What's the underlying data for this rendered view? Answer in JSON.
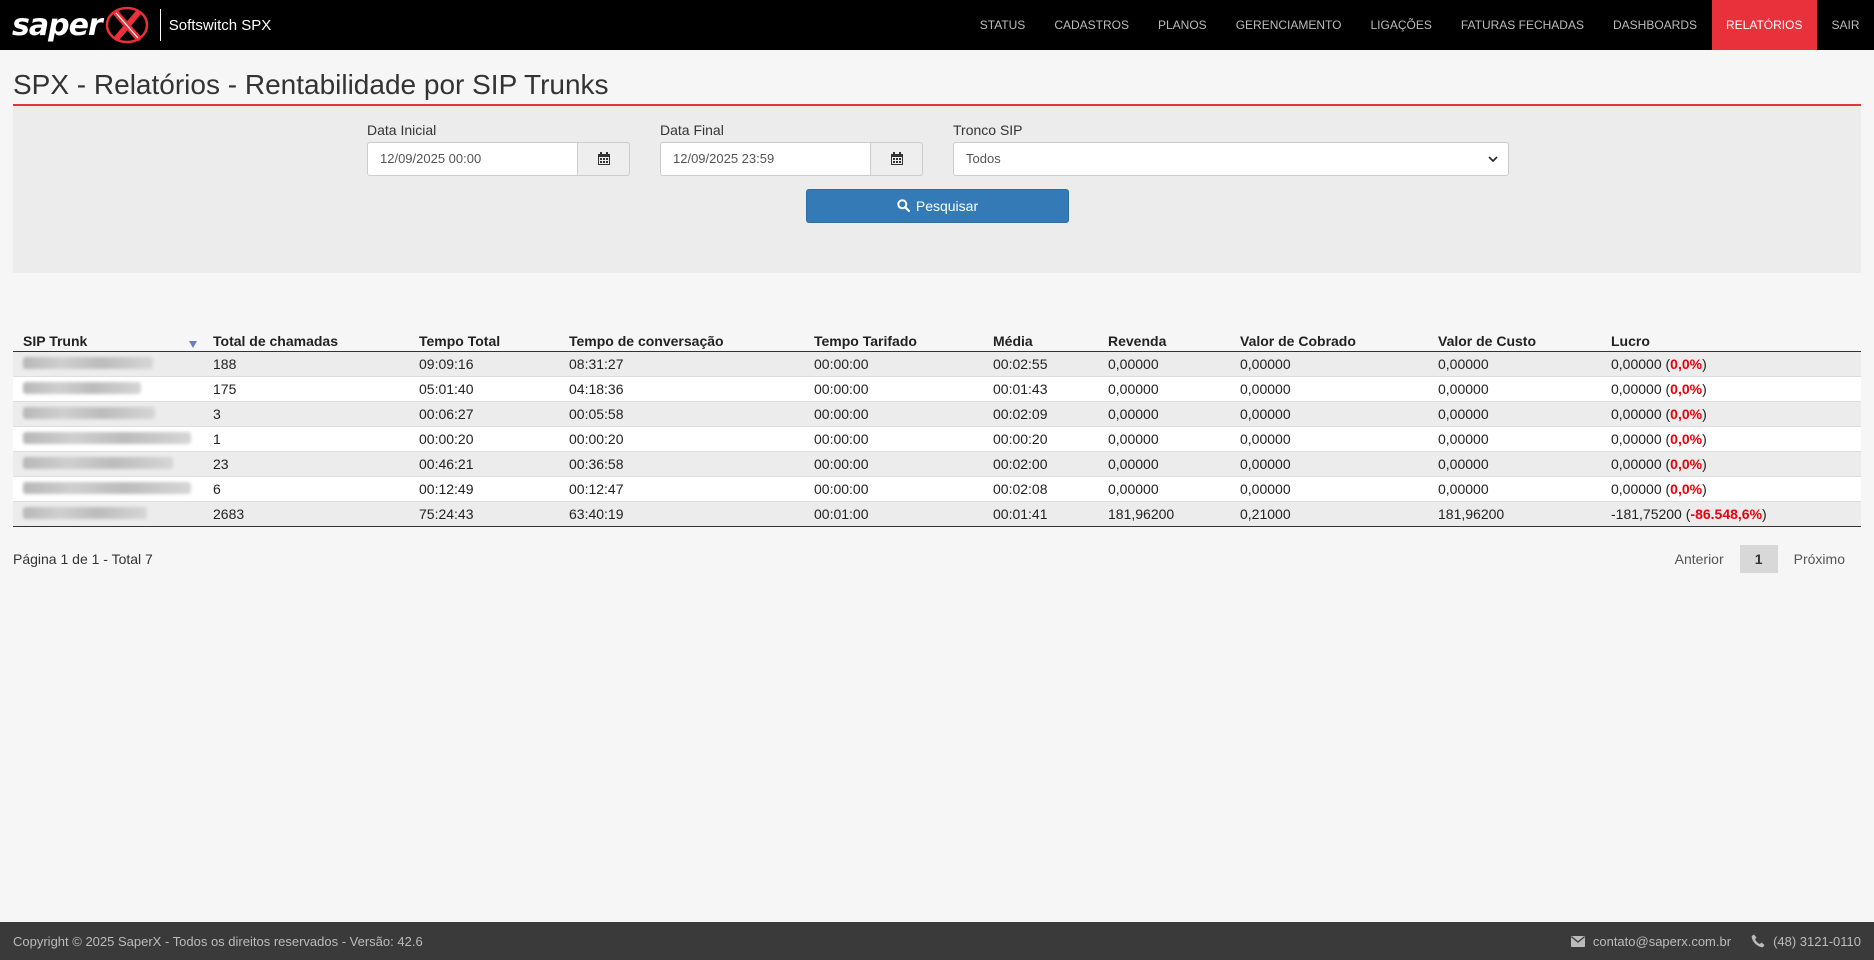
{
  "brand": {
    "logo_text": "saper",
    "product": "Softswitch SPX"
  },
  "nav": [
    {
      "label": "STATUS",
      "name": "nav-status"
    },
    {
      "label": "CADASTROS",
      "name": "nav-cadastros"
    },
    {
      "label": "PLANOS",
      "name": "nav-planos"
    },
    {
      "label": "GERENCIAMENTO",
      "name": "nav-gerenciamento"
    },
    {
      "label": "LIGAÇÕES",
      "name": "nav-ligacoes"
    },
    {
      "label": "FATURAS FECHADAS",
      "name": "nav-faturas-fechadas"
    },
    {
      "label": "DASHBOARDS",
      "name": "nav-dashboards"
    },
    {
      "label": "RELATÓRIOS",
      "name": "nav-relatorios",
      "active": true
    },
    {
      "label": "SAIR",
      "name": "nav-sair"
    }
  ],
  "page": {
    "title": "SPX - Relatórios - Rentabilidade por SIP Trunks"
  },
  "filters": {
    "start_label": "Data Inicial",
    "start_value": "12/09/2025 00:00",
    "end_label": "Data Final",
    "end_value": "12/09/2025 23:59",
    "trunk_label": "Tronco SIP",
    "trunk_value": "Todos",
    "search_label": "Pesquisar"
  },
  "table": {
    "columns": [
      "SIP Trunk",
      "Total de chamadas",
      "Tempo Total",
      "Tempo de conversação",
      "Tempo Tarifado",
      "Média",
      "Revenda",
      "Valor de Cobrado",
      "Valor de Custo",
      "Lucro"
    ],
    "rows": [
      {
        "total": "188",
        "tempo_total": "09:09:16",
        "conversacao": "08:31:27",
        "tarifado": "00:00:00",
        "media": "00:02:55",
        "revenda": "0,00000",
        "cobrado": "0,00000",
        "custo": "0,00000",
        "lucro": "0,00000",
        "lucro_pct": "0,0%"
      },
      {
        "total": "175",
        "tempo_total": "05:01:40",
        "conversacao": "04:18:36",
        "tarifado": "00:00:00",
        "media": "00:01:43",
        "revenda": "0,00000",
        "cobrado": "0,00000",
        "custo": "0,00000",
        "lucro": "0,00000",
        "lucro_pct": "0,0%"
      },
      {
        "total": "3",
        "tempo_total": "00:06:27",
        "conversacao": "00:05:58",
        "tarifado": "00:00:00",
        "media": "00:02:09",
        "revenda": "0,00000",
        "cobrado": "0,00000",
        "custo": "0,00000",
        "lucro": "0,00000",
        "lucro_pct": "0,0%"
      },
      {
        "total": "1",
        "tempo_total": "00:00:20",
        "conversacao": "00:00:20",
        "tarifado": "00:00:00",
        "media": "00:00:20",
        "revenda": "0,00000",
        "cobrado": "0,00000",
        "custo": "0,00000",
        "lucro": "0,00000",
        "lucro_pct": "0,0%"
      },
      {
        "total": "23",
        "tempo_total": "00:46:21",
        "conversacao": "00:36:58",
        "tarifado": "00:00:00",
        "media": "00:02:00",
        "revenda": "0,00000",
        "cobrado": "0,00000",
        "custo": "0,00000",
        "lucro": "0,00000",
        "lucro_pct": "0,0%"
      },
      {
        "total": "6",
        "tempo_total": "00:12:49",
        "conversacao": "00:12:47",
        "tarifado": "00:00:00",
        "media": "00:02:08",
        "revenda": "0,00000",
        "cobrado": "0,00000",
        "custo": "0,00000",
        "lucro": "0,00000",
        "lucro_pct": "0,0%"
      },
      {
        "total": "2683",
        "tempo_total": "75:24:43",
        "conversacao": "63:40:19",
        "tarifado": "00:01:00",
        "media": "00:01:41",
        "revenda": "181,96200",
        "cobrado": "0,21000",
        "custo": "181,96200",
        "lucro": "-181,75200",
        "lucro_pct": "-86.548,6%"
      }
    ]
  },
  "pagination": {
    "info": "Página 1 de 1 - Total 7",
    "prev": "Anterior",
    "current": "1",
    "next": "Próximo"
  },
  "footer": {
    "copyright": "Copyright © 2025 SaperX - Todos os direitos reservados - Versão: 42.6",
    "email": "contato@saperx.com.br",
    "phone": "(48) 3121-0110"
  },
  "colors": {
    "accent": "#e8313a",
    "primary": "#337ab7",
    "negative": "#e8000b"
  }
}
